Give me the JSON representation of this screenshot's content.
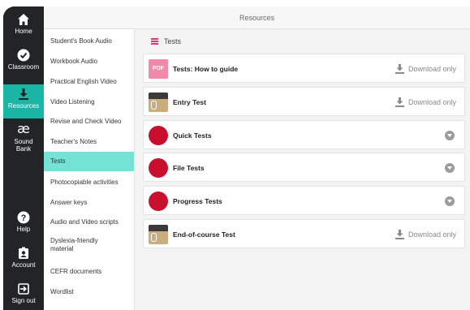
{
  "window": {
    "title": "Resources"
  },
  "rail": {
    "items": [
      {
        "label": "Home",
        "icon": "home-icon"
      },
      {
        "label": "Classroom",
        "icon": "check-circle-icon"
      },
      {
        "label": "Resources",
        "icon": "download-icon",
        "active": true
      },
      {
        "label": "Sound Bank",
        "icon": "ae-ligature-icon"
      },
      {
        "label": "Help",
        "icon": "question-icon"
      },
      {
        "label": "Account",
        "icon": "account-icon"
      },
      {
        "label": "Sign out",
        "icon": "sign-out-icon"
      }
    ],
    "accent": "#19b5a5"
  },
  "menu": {
    "items": [
      {
        "label": "Student's Book Audio"
      },
      {
        "label": "Workbook Audio"
      },
      {
        "label": "Practical English Video"
      },
      {
        "label": "Video Listening"
      },
      {
        "label": "Revise and Check Video"
      },
      {
        "label": "Teacher's Notes"
      },
      {
        "label": "Tests",
        "active": true
      },
      {
        "label": "Photocopiable activities"
      },
      {
        "label": "Answer keys"
      },
      {
        "label": "Audio and Video scripts"
      },
      {
        "label": "Dyslexia-friendly material"
      },
      {
        "label": "CEFR documents"
      },
      {
        "label": "Wordlist"
      }
    ],
    "active_color": "#74e2d4"
  },
  "content": {
    "section_title": "Tests",
    "rows": [
      {
        "title": "Tests: How to guide",
        "thumb": "pdf",
        "thumb_text": "PDF",
        "action": "Download only"
      },
      {
        "title": "Entry Test",
        "thumb": "book",
        "action": "Download only"
      },
      {
        "title": "Quick Tests",
        "thumb": "circle",
        "action": ""
      },
      {
        "title": "File Tests",
        "thumb": "circle",
        "action": ""
      },
      {
        "title": "Progress Tests",
        "thumb": "circle",
        "action": ""
      },
      {
        "title": "End-of-course Test",
        "thumb": "book",
        "action": "Download only"
      }
    ],
    "circle_color": "#c8102e",
    "pdf_color": "#f08aa8"
  }
}
